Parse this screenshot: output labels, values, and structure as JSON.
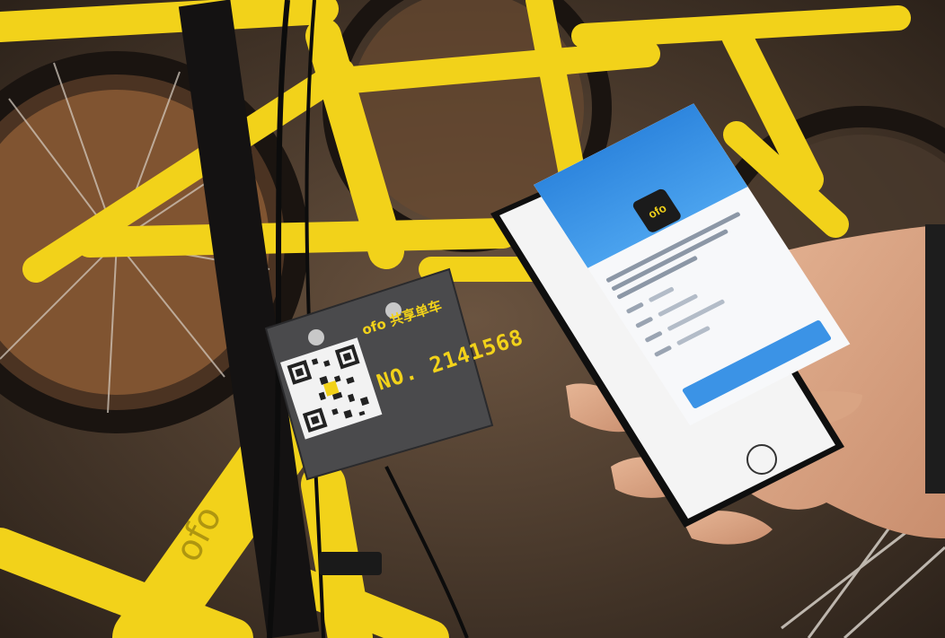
{
  "plate": {
    "brand": "ofo 共享单车",
    "number": "NO. 2141568"
  },
  "frame": {
    "logo": "ofo"
  },
  "phone": {
    "app_icon_text": "ofo"
  },
  "colors": {
    "bike_yellow": "#f2d21a",
    "plate_gray": "#4a4a4c",
    "screen_blue": "#2e86de"
  }
}
